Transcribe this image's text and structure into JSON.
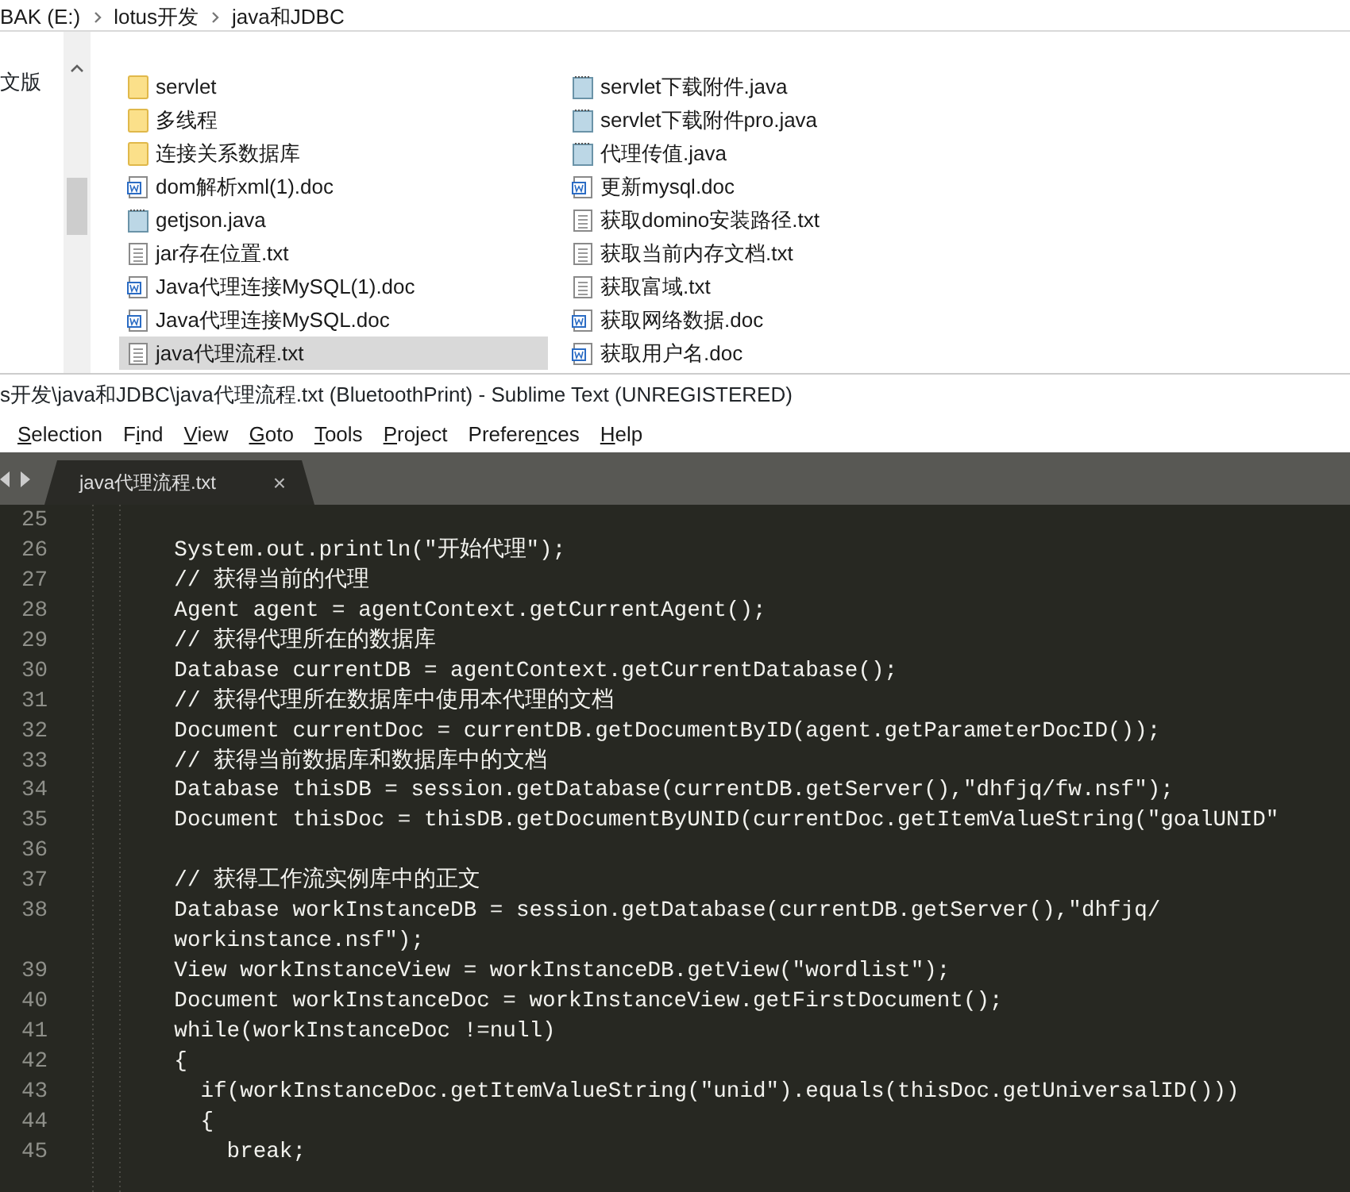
{
  "explorer": {
    "breadcrumb": [
      "BAK (E:)",
      "lotus开发",
      "java和JDBC"
    ],
    "nav_pane": {
      "label": "文版"
    },
    "files": [
      {
        "name": "servlet",
        "kind": "folder",
        "selected": false
      },
      {
        "name": "多线程",
        "kind": "folder",
        "selected": false
      },
      {
        "name": "连接关系数据库",
        "kind": "folder",
        "selected": false
      },
      {
        "name": "dom解析xml(1).doc",
        "kind": "doc",
        "selected": false
      },
      {
        "name": "getjson.java",
        "kind": "java",
        "selected": false
      },
      {
        "name": "jar存在位置.txt",
        "kind": "txt",
        "selected": false
      },
      {
        "name": "Java代理连接MySQL(1).doc",
        "kind": "doc",
        "selected": false
      },
      {
        "name": "Java代理连接MySQL.doc",
        "kind": "doc",
        "selected": false
      },
      {
        "name": "java代理流程.txt",
        "kind": "txt",
        "selected": true
      },
      {
        "name": "servlet下载附件.java",
        "kind": "java",
        "selected": false
      },
      {
        "name": "servlet下载附件pro.java",
        "kind": "java",
        "selected": false
      },
      {
        "name": "代理传值.java",
        "kind": "java",
        "selected": false
      },
      {
        "name": "更新mysql.doc",
        "kind": "doc",
        "selected": false
      },
      {
        "name": "获取domino安装路径.txt",
        "kind": "txt",
        "selected": false
      },
      {
        "name": "获取当前内存文档.txt",
        "kind": "txt",
        "selected": false
      },
      {
        "name": "获取富域.txt",
        "kind": "txt",
        "selected": false
      },
      {
        "name": "获取网络数据.doc",
        "kind": "doc",
        "selected": false
      },
      {
        "name": "获取用户名.doc",
        "kind": "doc",
        "selected": false
      }
    ]
  },
  "editor": {
    "title": "s开发\\java和JDBC\\java代理流程.txt (BluetoothPrint) - Sublime Text (UNREGISTERED)",
    "menu": [
      {
        "key": "S",
        "post": "election"
      },
      {
        "pre": "F",
        "key": "i",
        "post": "nd"
      },
      {
        "key": "V",
        "post": "iew"
      },
      {
        "key": "G",
        "post": "oto"
      },
      {
        "key": "T",
        "post": "ools"
      },
      {
        "key": "P",
        "post": "roject"
      },
      {
        "pre": "Prefere",
        "key": "n",
        "post": "ces"
      },
      {
        "key": "H",
        "post": "elp"
      }
    ],
    "tabs": [
      {
        "label": "java代理流程.txt",
        "selected": true,
        "close": "×"
      }
    ],
    "lines": [
      {
        "number": "25",
        "rows": [
          ""
        ]
      },
      {
        "number": "26",
        "rows": [
          "      System.out.println(\"开始代理\");"
        ]
      },
      {
        "number": "27",
        "rows": [
          "      // 获得当前的代理"
        ]
      },
      {
        "number": "28",
        "rows": [
          "      Agent agent = agentContext.getCurrentAgent();"
        ]
      },
      {
        "number": "29",
        "rows": [
          "      // 获得代理所在的数据库"
        ]
      },
      {
        "number": "30",
        "rows": [
          "      Database currentDB = agentContext.getCurrentDatabase();"
        ]
      },
      {
        "number": "31",
        "rows": [
          "      // 获得代理所在数据库中使用本代理的文档"
        ]
      },
      {
        "number": "32",
        "rows": [
          "      Document currentDoc = currentDB.getDocumentByID(agent.getParameterDocID());"
        ]
      },
      {
        "number": "33",
        "rows": [
          "      // 获得当前数据库和数据库中的文档"
        ]
      },
      {
        "number": "34",
        "rows": [
          "      Database thisDB = session.getDatabase(currentDB.getServer(),\"dhfjq/fw.nsf\");"
        ]
      },
      {
        "number": "35",
        "rows": [
          "      Document thisDoc = thisDB.getDocumentByUNID(currentDoc.getItemValueString(\"goalUNID\""
        ]
      },
      {
        "number": "36",
        "rows": [
          ""
        ]
      },
      {
        "number": "37",
        "rows": [
          "      // 获得工作流实例库中的正文"
        ]
      },
      {
        "number": "38",
        "rows": [
          "      Database workInstanceDB = session.getDatabase(currentDB.getServer(),\"dhfjq/",
          "      workinstance.nsf\");"
        ]
      },
      {
        "number": "39",
        "rows": [
          "      View workInstanceView = workInstanceDB.getView(\"wordlist\");"
        ]
      },
      {
        "number": "40",
        "rows": [
          "      Document workInstanceDoc = workInstanceView.getFirstDocument();"
        ]
      },
      {
        "number": "41",
        "rows": [
          "      while(workInstanceDoc !=null)"
        ]
      },
      {
        "number": "42",
        "rows": [
          "      {"
        ]
      },
      {
        "number": "43",
        "rows": [
          "        if(workInstanceDoc.getItemValueString(\"unid\").equals(thisDoc.getUniversalID()))"
        ]
      },
      {
        "number": "44",
        "rows": [
          "        {"
        ]
      },
      {
        "number": "45",
        "rows": [
          "          break;"
        ]
      }
    ]
  }
}
